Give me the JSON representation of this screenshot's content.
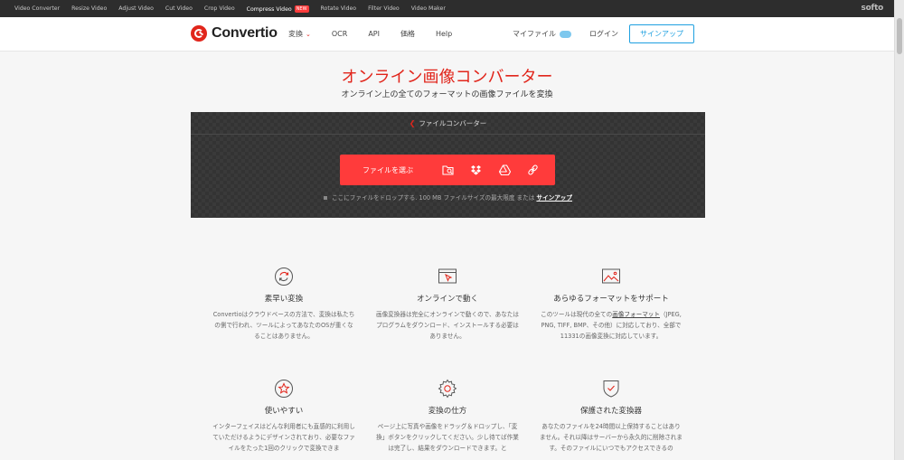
{
  "topbar": {
    "links": [
      "Video Converter",
      "Resize Video",
      "Adjust Video",
      "Cut Video",
      "Crop Video",
      "Compress Video",
      "Rotate Video",
      "Filter Video",
      "Video Maker"
    ],
    "active_index": 5,
    "new_badge": "NEW",
    "brand": "softo"
  },
  "nav": {
    "logo": "Convertio",
    "menu": [
      "変換",
      "OCR",
      "API",
      "価格",
      "Help"
    ],
    "my_files": "マイファイル",
    "login": "ログイン",
    "signup": "サインアップ"
  },
  "hero": {
    "title": "オンライン画像コンバーター",
    "subtitle": "オンライン上の全てのフォーマットの画像ファイルを変換"
  },
  "converter": {
    "breadcrumb": "ファイルコンバーター",
    "choose_files": "ファイルを選ぶ",
    "drop_text": "ここにファイルをドロップする. 100 MB ファイルサイズの最大限度 または",
    "drop_link": "サインアップ"
  },
  "features": [
    {
      "icon": "refresh-icon",
      "title": "素早い変換",
      "desc": "Convertioはクラウドベースの方法で、変換は私たちの側で行われ、ツールによってあなたのOSが重くなることはありません。"
    },
    {
      "icon": "browser-cursor-icon",
      "title": "オンラインで動く",
      "desc": "画像変換器は完全にオンラインで動くので、あなたはプログラムをダウンロード、インストールする必要はありません。"
    },
    {
      "icon": "image-icon",
      "title": "あらゆるフォーマットをサポート",
      "desc_pre": "このツールは現代の全ての",
      "desc_link": "画像フォーマット",
      "desc_post": "（JPEG, PNG, TIFF, BMP、その他）に対応しており、全部で11331の画像変換に対応しています。"
    },
    {
      "icon": "star-icon",
      "title": "使いやすい",
      "desc": "インターフェイスはどんな利用者にも直感的に利用していただけるようにデザインされており、必要なファイルをたった1回のクリックで変換できま"
    },
    {
      "icon": "gear-icon",
      "title": "変換の仕方",
      "desc": "ページ上に写真や画像をドラッグ＆ドロップし、「変換」ボタンをクリックしてください。少し待てば作業は完了し、結果をダウンロードできます。と"
    },
    {
      "icon": "shield-icon",
      "title": "保護された変換器",
      "desc": "あなたのファイルを24時間以上保持することはありません。それ以降はサーバーから永久的に削除されます。そのファイルにいつでもアクセスできるの"
    }
  ],
  "colors": {
    "accent": "#e1251b",
    "button": "#ff3b3b",
    "link": "#1ea0e0"
  }
}
